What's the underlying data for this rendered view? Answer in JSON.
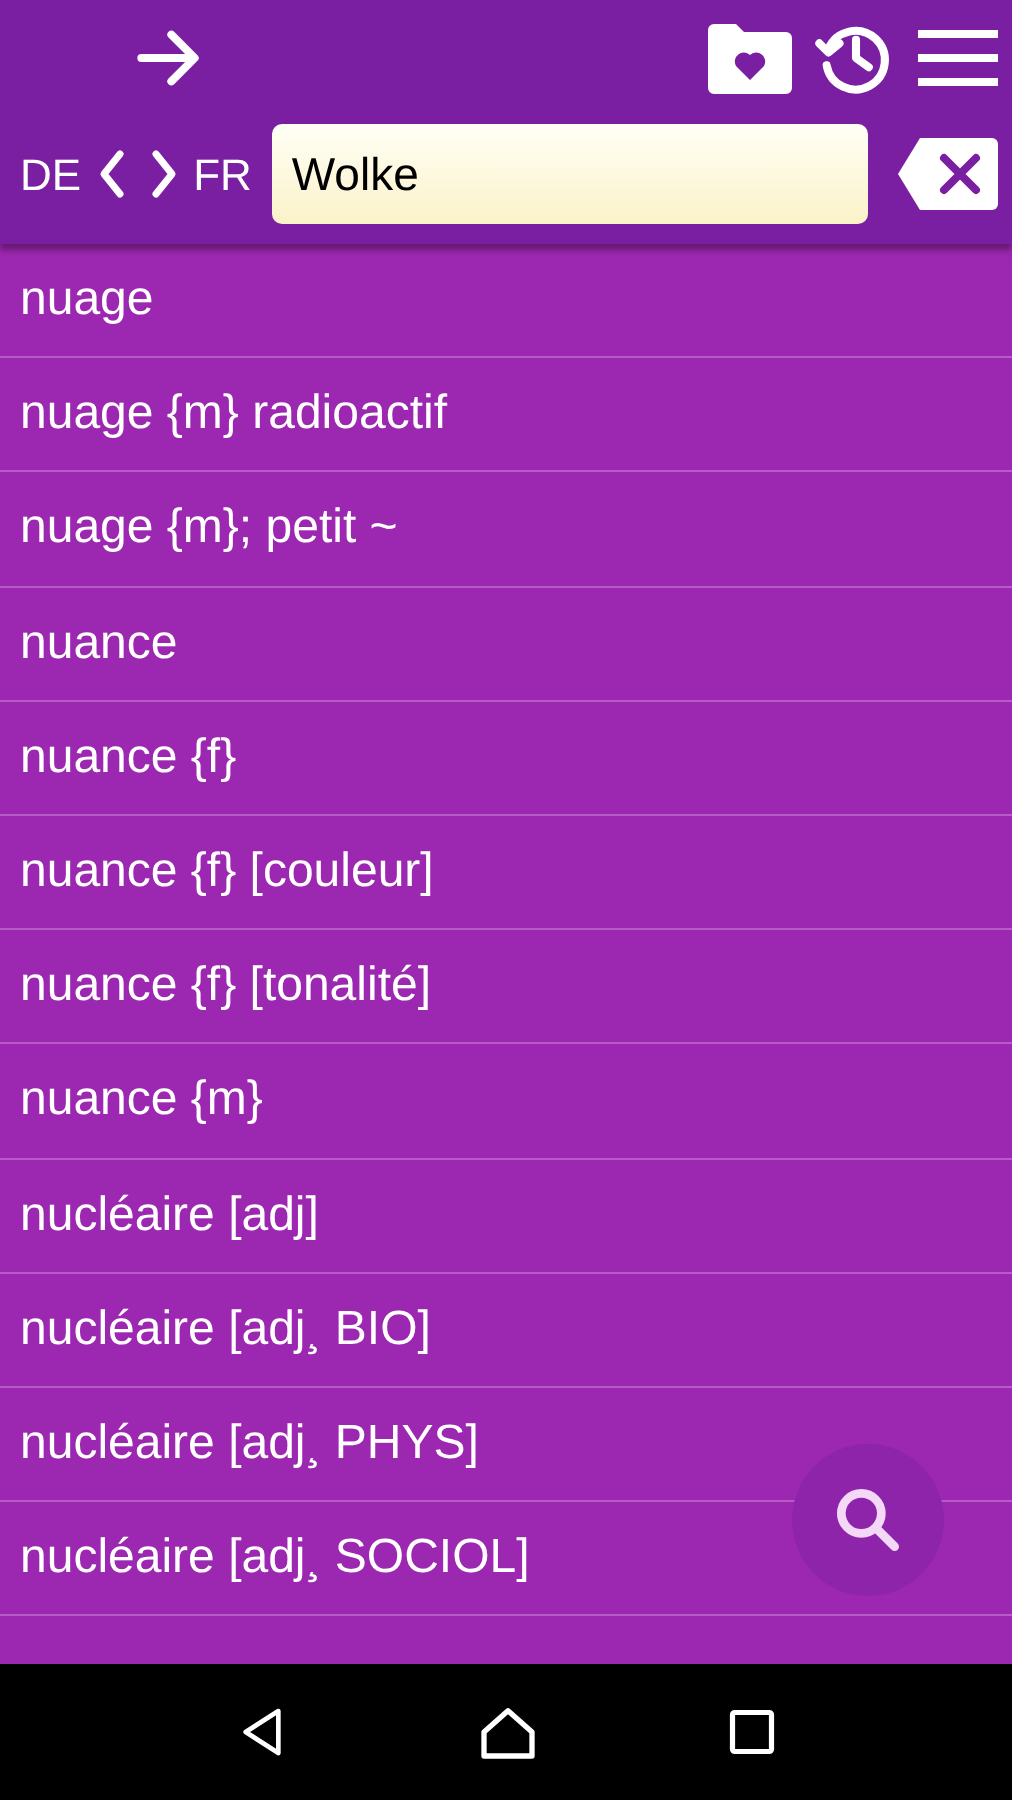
{
  "language_switch": {
    "source": "DE",
    "target": "FR"
  },
  "search": {
    "value": "Wolke"
  },
  "results": [
    "nuage",
    "nuage {m} radioactif",
    "nuage {m}; petit ~",
    "nuance",
    "nuance {f}",
    "nuance {f} [couleur]",
    "nuance {f} [tonalité]",
    "nuance {m}",
    "nucléaire [adj]",
    "nucléaire [adj¸ BIO]",
    "nucléaire [adj¸ PHYS]",
    "nucléaire [adj¸ SOCIOL]"
  ]
}
